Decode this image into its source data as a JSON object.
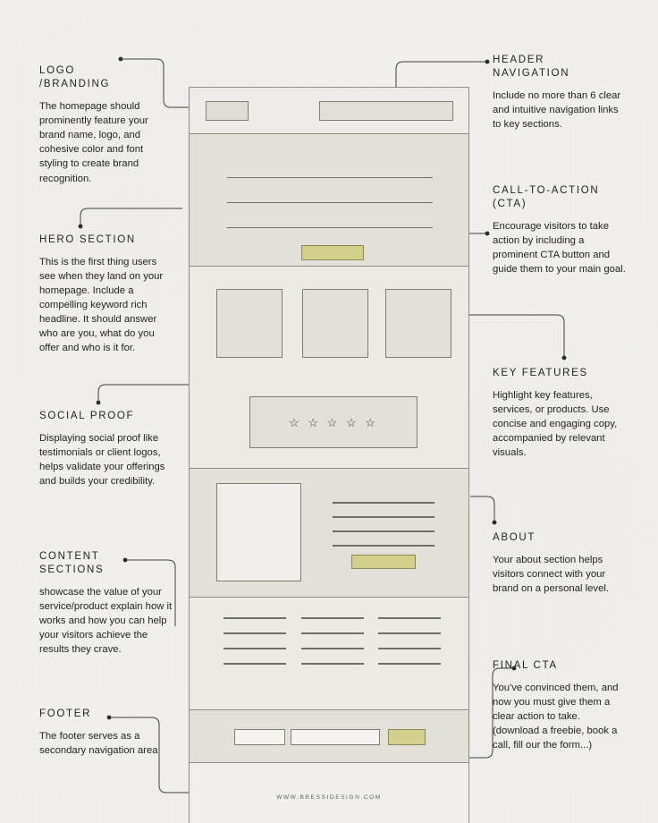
{
  "background_color": "#f2f1ee",
  "accent_color": "#d3d08c",
  "mockup": {
    "stars": "☆ ☆ ☆ ☆ ☆",
    "url": "WWW.BRESSIDESIGN.COM"
  },
  "annotations": [
    {
      "id": "logo",
      "title": "LOGO\n/BRANDING",
      "body": "The homepage should prominently feature your brand name, logo, and cohesive color and font styling to create brand recognition."
    },
    {
      "id": "header-nav",
      "title": "HEADER\nNAVIGATION",
      "body": " Include no more than 6 clear and intuitive navigation links to key sections."
    },
    {
      "id": "cta",
      "title": "CALL-TO-ACTION\n(CTA)",
      "body": "Encourage visitors to take action by including a prominent CTA button and guide them to your main goal."
    },
    {
      "id": "hero",
      "title": "HERO SECTION",
      "body": "This is the first thing users see when they land on your homepage. Include a compelling keyword rich headline. It should answer who are you, what do you offer and who is it for."
    },
    {
      "id": "features",
      "title": "KEY FEATURES",
      "body": "Highlight key features, services, or products. Use concise and engaging copy, accompanied by relevant visuals."
    },
    {
      "id": "social",
      "title": "SOCIAL PROOF",
      "body": "Displaying social proof like testimonials or client logos, helps validate your offerings and builds your credibility."
    },
    {
      "id": "about",
      "title": "ABOUT",
      "body": "Your about section helps visitors connect with your brand on a personal level."
    },
    {
      "id": "content",
      "title": "CONTENT\nSECTIONS",
      "body": " showcase the value of your service/product explain how it works and how you can help your visitors achieve the results they crave."
    },
    {
      "id": "final-cta",
      "title": "FINAL CTA",
      "body": "You've convinced them, and now you must give them a clear action to take. (download a freebie, book a call, fill our the form...)"
    },
    {
      "id": "footer",
      "title": "FOOTER",
      "body": "The footer serves as a secondary navigation area"
    }
  ]
}
